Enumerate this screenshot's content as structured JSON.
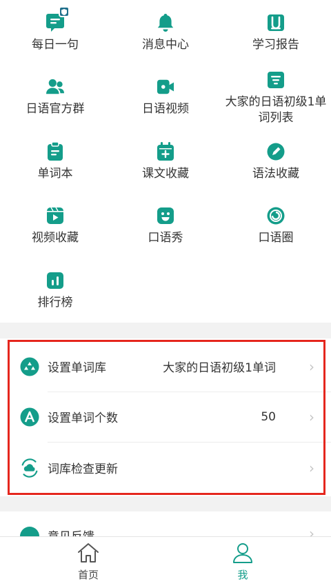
{
  "colors": {
    "accent": "#149d8a",
    "highlight_border": "#e5261d",
    "badge": "#1f6f8b"
  },
  "grid": [
    {
      "label": "每日一句",
      "icon": "daily-sentence-icon"
    },
    {
      "label": "消息中心",
      "icon": "bell-icon"
    },
    {
      "label": "学习报告",
      "icon": "report-book-icon"
    },
    {
      "label": "日语官方群",
      "icon": "group-icon"
    },
    {
      "label": "日语视频",
      "icon": "video-camera-icon"
    },
    {
      "label": "大家的日语初级1单词列表",
      "icon": "word-list-icon"
    },
    {
      "label": "单词本",
      "icon": "clipboard-icon"
    },
    {
      "label": "课文收藏",
      "icon": "calendar-plus-icon"
    },
    {
      "label": "语法收藏",
      "icon": "pencil-icon"
    },
    {
      "label": "视频收藏",
      "icon": "play-icon"
    },
    {
      "label": "口语秀",
      "icon": "smile-icon"
    },
    {
      "label": "口语圈",
      "icon": "circle-icon"
    },
    {
      "label": "排行榜",
      "icon": "bar-chart-icon"
    }
  ],
  "settings": {
    "word_library": {
      "label": "设置单词库",
      "value": "大家的日语初级1单词"
    },
    "word_count": {
      "label": "设置单词个数",
      "value": "50"
    },
    "check_update": {
      "label": "词库检查更新"
    }
  },
  "feedback": {
    "label": "意见反馈"
  },
  "tabs": {
    "home": "首页",
    "me": "我"
  }
}
